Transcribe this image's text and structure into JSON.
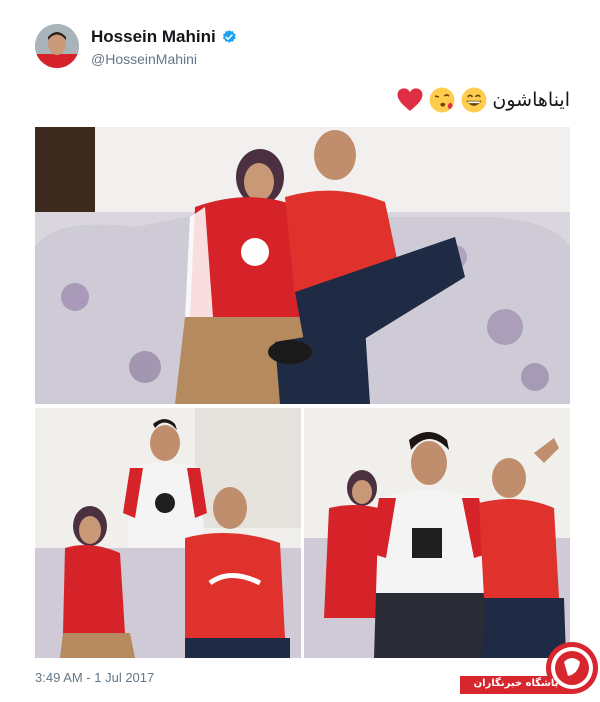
{
  "user": {
    "display_name": "Hossein Mahini",
    "handle": "@HosseinMahini",
    "verified_icon": "verified-badge-icon"
  },
  "tweet": {
    "text": "ایناهاشون",
    "emojis": [
      "grinning-face-emoji",
      "face-blowing-kiss-emoji",
      "red-heart-emoji"
    ]
  },
  "photos": [
    {
      "subject": "couple-on-sofa-photo"
    },
    {
      "subject": "family-group-photo-left"
    },
    {
      "subject": "family-group-photo-right"
    }
  ],
  "timestamp": "3:49 AM - 1 Jul 2017",
  "watermark": {
    "text": "باشگاه خبرنگاران",
    "logo_icon": "yjc-logo-icon"
  },
  "colors": {
    "handle_gray": "#657786",
    "verified_blue": "#1da1f2",
    "jersey_red": "#d6232a",
    "watermark_red": "#d7262d"
  }
}
